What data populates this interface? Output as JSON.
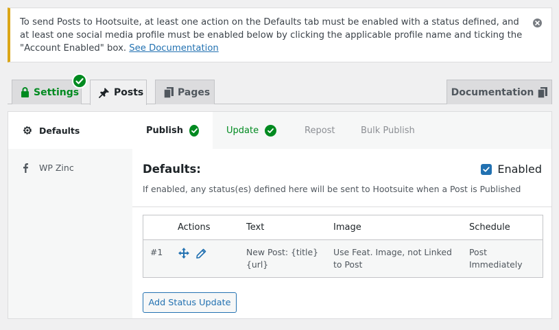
{
  "notice": {
    "text": "To send Posts to Hootsuite, at least one action on the Defaults tab must be enabled with a status defined, and at least one social media profile must be enabled below by clicking the applicable profile name and ticking the \"Account Enabled\" box.",
    "link_label": "See Documentation"
  },
  "tabs": {
    "settings": "Settings",
    "posts": "Posts",
    "pages": "Pages",
    "documentation": "Documentation"
  },
  "sidebar": {
    "items": [
      {
        "label": "Defaults",
        "icon": "gear-icon"
      },
      {
        "label": "WP Zinc",
        "icon": "facebook-icon"
      }
    ]
  },
  "subtabs": [
    "Publish",
    "Update",
    "Repost",
    "Bulk Publish"
  ],
  "defaults": {
    "title": "Defaults:",
    "description": "If enabled, any status(es) defined here will be sent to Hootsuite when a Post is Published",
    "enabled_label": "Enabled",
    "enabled": true
  },
  "table": {
    "columns": [
      "Actions",
      "Text",
      "Image",
      "Schedule"
    ],
    "rows": [
      {
        "number": "#1",
        "text_line1": "New Post: {title}",
        "text_line2": "{url}",
        "image_line1": "Use Feat. Image, not Linked",
        "image_line2": "to Post",
        "schedule_line1": "Post",
        "schedule_line2": "Immediately"
      }
    ]
  },
  "add_button": "Add Status Update",
  "colors": {
    "accent": "#2271b1",
    "success": "#008a20",
    "warning": "#dba617"
  }
}
